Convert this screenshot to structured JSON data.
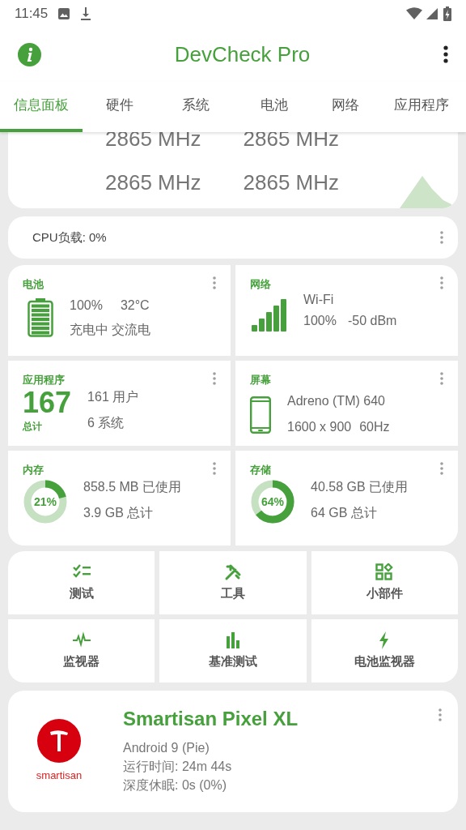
{
  "status_bar": {
    "time": "11:45"
  },
  "app_bar": {
    "title": "DevCheck Pro"
  },
  "tabs": [
    {
      "label": "信息面板",
      "selected": true
    },
    {
      "label": "硬件",
      "selected": false
    },
    {
      "label": "系统",
      "selected": false
    },
    {
      "label": "电池",
      "selected": false
    },
    {
      "label": "网络",
      "selected": false
    },
    {
      "label": "应用程序",
      "selected": false
    }
  ],
  "cpu_card": {
    "frequencies": [
      "2865 MHz",
      "2865 MHz",
      "2865 MHz",
      "2865 MHz"
    ]
  },
  "cpu_load": {
    "label": "CPU负载: 0%"
  },
  "cards": [
    {
      "kind": "battery",
      "title": "电池",
      "percent": "100%",
      "temperature": "32°C",
      "status": "充电中 交流电"
    },
    {
      "kind": "network",
      "title": "网络",
      "type": "Wi-Fi",
      "strength": "100%",
      "signal": "-50 dBm"
    },
    {
      "kind": "apps",
      "title": "应用程序",
      "total": "167",
      "total_label": "总计",
      "user": "161 用户",
      "system": "6 系统"
    },
    {
      "kind": "display",
      "title": "屏幕",
      "gpu": "Adreno (TM) 640",
      "resolution": "1600 x 900",
      "refresh": "60Hz"
    },
    {
      "kind": "memory",
      "title": "内存",
      "level": 0.21,
      "percent": "21%",
      "used": "858.5 MB 已使用",
      "total": "3.9 GB 总计"
    },
    {
      "kind": "storage",
      "title": "存储",
      "level": 0.64,
      "percent": "64%",
      "used": "40.58 GB 已使用",
      "total": "64 GB 总计"
    }
  ],
  "shortcuts": [
    {
      "kind": "tests",
      "label": "测试"
    },
    {
      "kind": "tools",
      "label": "工具"
    },
    {
      "kind": "widgets",
      "label": "小部件"
    },
    {
      "kind": "monitor",
      "label": "监视器"
    },
    {
      "kind": "benchmark",
      "label": "基准测试"
    },
    {
      "kind": "battery_monitor",
      "label": "电池监视器"
    }
  ],
  "device": {
    "brand": "smartisan",
    "name": "Smartisan Pixel XL",
    "os": "Android 9 (Pie)",
    "uptime": "运行时间: 24m 44s",
    "deep_sleep": "深度休眠: 0s (0%)"
  }
}
